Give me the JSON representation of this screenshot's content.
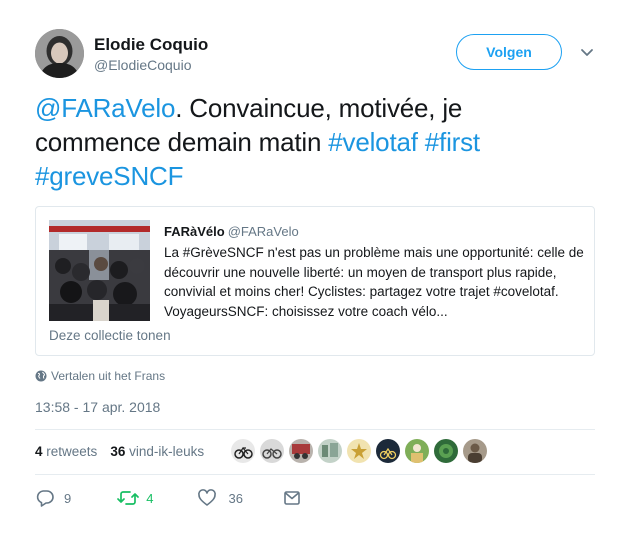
{
  "author": {
    "name": "Elodie Coquio",
    "handle": "@ElodieCoquio"
  },
  "follow_button": "Volgen",
  "tweet": {
    "mention": "@FARaVelo",
    "text_part1": ". Convaincue, motivée, je commence demain matin ",
    "hashtag1": "#velotaf",
    "hashtag2": "#first",
    "hashtag3": "#greveSNCF"
  },
  "quoted": {
    "name": "FARàVélo",
    "handle": "@FARaVelo",
    "text": "La #GrèveSNCF n'est pas un problème mais une opportunité: celle de découvrir une nouvelle liberté: un moyen de transport plus rapide, convivial et moins cher! Cyclistes: partagez votre trajet #covelotaf. VoyageursSNCF: choisissez votre coach vélo...",
    "collection_link": "Deze collectie tonen"
  },
  "translate_link": "Vertalen uit het Frans",
  "timestamp": "13:58 - 17 apr. 2018",
  "stats": {
    "retweets_count": "4",
    "retweets_label": "retweets",
    "likes_count": "36",
    "likes_label": "vind-ik-leuks"
  },
  "liker_avatar_count": 9,
  "actions": {
    "reply_count": "9",
    "retweet_count": "4",
    "like_count": "36"
  },
  "colors": {
    "link": "#1b95e0",
    "follow": "#1da1f2",
    "retweet": "#17bf63",
    "muted": "#657786"
  }
}
